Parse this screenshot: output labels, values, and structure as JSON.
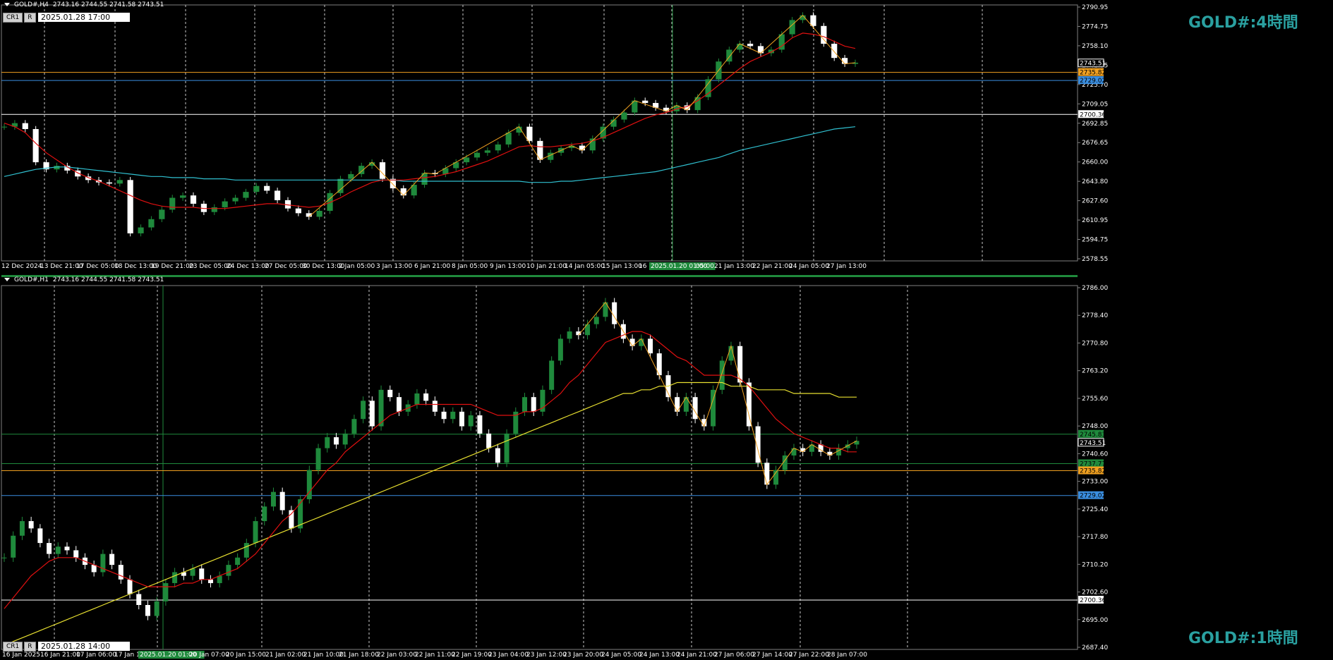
{
  "colors": {
    "bg": "#000000",
    "bull": "#1f8a3c",
    "bear": "#ffffff",
    "ma_fast": "#e01010",
    "ma_mid": "#30c0d0",
    "ma_slow": "#e8e030",
    "zigzag": "#f0a020",
    "grid": "#c8c8c8",
    "hline_white": "#ffffff",
    "hline_orange": "#f0a020",
    "hline_blue": "#3a8ee0",
    "hline_green": "#1f8a3c",
    "watermark": "#2aa0a0"
  },
  "panes": [
    {
      "id": "h4",
      "header": {
        "symbol": "GOLD#,H4",
        "ohlc": "2743.16 2744.55 2741.58 2743.51"
      },
      "buttons": [
        "CR1",
        "R"
      ],
      "datetime_box": "2025.01.28 17:00",
      "watermark": "GOLD#:4時間",
      "y_ticks": [
        "2790.95",
        "2774.75",
        "2758.10",
        "2741.35",
        "2725.70",
        "2709.05",
        "2692.85",
        "2676.65",
        "2660.00",
        "2643.80",
        "2627.60",
        "2610.95",
        "2594.75",
        "2578.55"
      ],
      "x_ticks": [
        "12 Dec 2024",
        "13 Dec 21:00",
        "17 Dec 05:00",
        "18 Dec 13:00",
        "19 Dec 21:00",
        "23 Dec 05:00",
        "24 Dec 13:00",
        "27 Dec 05:00",
        "30 Dec 13:00",
        "2 Jan 05:00",
        "3 Jan 13:00",
        "6 Jan 21:00",
        "8 Jan 05:00",
        "9 Jan 13:00",
        "10 Jan 21:00",
        "14 Jan 05:00",
        "15 Jan 13:00",
        "16",
        "2025.01.20 01:00",
        "05:00",
        "21 Jan 13:00",
        "22 Jan 21:00",
        "24 Jan 05:00",
        "27 Jan 13:00"
      ],
      "price_tags": [
        {
          "text": "2743.51",
          "price": 2743.51,
          "style": "current"
        },
        {
          "text": "2735.82",
          "price": 2735.82,
          "style": "orange"
        },
        {
          "text": "2729.02",
          "price": 2729.02,
          "style": "blue"
        },
        {
          "text": "2700.36",
          "price": 2700.36,
          "style": "white"
        }
      ]
    },
    {
      "id": "h1",
      "header": {
        "symbol": "GOLD#,H1",
        "ohlc": "2743.16 2744.55 2741.58 2743.51"
      },
      "buttons": [
        "CR1",
        "R"
      ],
      "datetime_box": "2025.01.28 14:00",
      "watermark": "GOLD#:1時間",
      "y_ticks": [
        "2786.00",
        "2778.40",
        "2770.80",
        "2763.20",
        "2755.60",
        "2748.00",
        "2740.60",
        "2733.00",
        "2725.40",
        "2717.80",
        "2710.20",
        "2702.60",
        "2695.00",
        "2687.40"
      ],
      "x_ticks": [
        "16 Jan 2025",
        "16 Jan 21:00",
        "17 Jan 06:00",
        "17 Jan 14",
        "2025.01.20 01:00",
        "20 Jan 07:00",
        "20 Jan 15:00",
        "21 Jan 02:00",
        "21 Jan 10:00",
        "21 Jan 18:00",
        "22 Jan 03:00",
        "22 Jan 11:00",
        "22 Jan 19:00",
        "23 Jan 04:00",
        "23 Jan 12:00",
        "23 Jan 20:00",
        "24 Jan 05:00",
        "24 Jan 13:00",
        "24 Jan 21:00",
        "27 Jan 06:00",
        "27 Jan 14:00",
        "27 Jan 22:00",
        "28 Jan 07:00"
      ],
      "price_tags": [
        {
          "text": "2745.83",
          "price": 2745.83,
          "style": "green"
        },
        {
          "text": "2743.51",
          "price": 2743.51,
          "style": "current"
        },
        {
          "text": "2737.77",
          "price": 2737.77,
          "style": "green"
        },
        {
          "text": "2735.82",
          "price": 2735.82,
          "style": "orange"
        },
        {
          "text": "2729.02",
          "price": 2729.02,
          "style": "blue"
        },
        {
          "text": "2700.36",
          "price": 2700.36,
          "style": "white"
        }
      ]
    }
  ],
  "chart_data": [
    {
      "type": "candlestick",
      "title": "GOLD#,H4",
      "ylim": [
        2578.55,
        2790.95
      ],
      "horizontal_lines": [
        2735.82,
        2729.02,
        2700.36
      ],
      "close_path": [
        2690,
        2693,
        2688,
        2660,
        2654,
        2657,
        2653,
        2648,
        2645,
        2643,
        2642,
        2645,
        2600,
        2605,
        2612,
        2620,
        2630,
        2632,
        2625,
        2618,
        2622,
        2627,
        2630,
        2635,
        2640,
        2636,
        2628,
        2621,
        2617,
        2614,
        2619,
        2634,
        2646,
        2650,
        2657,
        2660,
        2646,
        2638,
        2632,
        2641,
        2651,
        2650,
        2655,
        2660,
        2664,
        2668,
        2670,
        2675,
        2685,
        2690,
        2678,
        2662,
        2668,
        2672,
        2674,
        2670,
        2680,
        2690,
        2696,
        2702,
        2712,
        2710,
        2706,
        2703,
        2708,
        2704,
        2715,
        2730,
        2745,
        2755,
        2760,
        2758,
        2752,
        2755,
        2768,
        2780,
        2784,
        2775,
        2760,
        2748,
        2743,
        2744
      ],
      "ma_fast": [
        2693,
        2690,
        2685,
        2676,
        2668,
        2662,
        2656,
        2651,
        2647,
        2644,
        2640,
        2636,
        2632,
        2628,
        2625,
        2623,
        2622,
        2622,
        2622,
        2621,
        2621,
        2621,
        2622,
        2623,
        2624,
        2625,
        2625,
        2624,
        2623,
        2622,
        2623,
        2626,
        2630,
        2635,
        2639,
        2643,
        2645,
        2645,
        2645,
        2646,
        2647,
        2648,
        2650,
        2652,
        2655,
        2658,
        2661,
        2665,
        2669,
        2673,
        2674,
        2673,
        2673,
        2674,
        2675,
        2676,
        2678,
        2681,
        2685,
        2689,
        2693,
        2697,
        2700,
        2702,
        2705,
        2707,
        2712,
        2718,
        2725,
        2732,
        2739,
        2745,
        2749,
        2753,
        2758,
        2765,
        2769,
        2768,
        2766,
        2762,
        2758,
        2756
      ],
      "ma_slow": [
        2648,
        2650,
        2652,
        2654,
        2655,
        2656,
        2656,
        2655,
        2654,
        2653,
        2652,
        2651,
        2650,
        2649,
        2648,
        2648,
        2647,
        2647,
        2647,
        2646,
        2646,
        2646,
        2645,
        2645,
        2645,
        2645,
        2645,
        2645,
        2645,
        2645,
        2645,
        2645,
        2645,
        2645,
        2645,
        2645,
        2645,
        2645,
        2644,
        2644,
        2644,
        2644,
        2644,
        2644,
        2644,
        2644,
        2644,
        2644,
        2644,
        2644,
        2643,
        2643,
        2643,
        2644,
        2644,
        2645,
        2646,
        2647,
        2648,
        2649,
        2650,
        2651,
        2652,
        2654,
        2656,
        2658,
        2660,
        2662,
        2664,
        2667,
        2670,
        2672,
        2674,
        2676,
        2678,
        2680,
        2682,
        2684,
        2686,
        2688,
        2689,
        2690
      ]
    },
    {
      "type": "candlestick",
      "title": "GOLD#,H1",
      "ylim": [
        2687.4,
        2786.0
      ],
      "horizontal_lines": [
        2745.83,
        2737.77,
        2735.82,
        2729.02,
        2700.36
      ],
      "close_path": [
        2712,
        2718,
        2722,
        2720,
        2716,
        2713,
        2715,
        2714,
        2712,
        2710,
        2708,
        2713,
        2710,
        2706,
        2702,
        2699,
        2696,
        2700,
        2705,
        2708,
        2707,
        2709,
        2706,
        2705,
        2707,
        2710,
        2712,
        2716,
        2722,
        2726,
        2730,
        2725,
        2720,
        2728,
        2736,
        2742,
        2745,
        2743,
        2746,
        2750,
        2755,
        2748,
        2758,
        2756,
        2752,
        2754,
        2757,
        2755,
        2752,
        2750,
        2752,
        2748,
        2751,
        2746,
        2742,
        2738,
        2746,
        2752,
        2756,
        2752,
        2758,
        2766,
        2772,
        2774,
        2773,
        2776,
        2778,
        2782,
        2776,
        2772,
        2770,
        2772,
        2768,
        2762,
        2756,
        2752,
        2756,
        2750,
        2748,
        2758,
        2766,
        2770,
        2760,
        2748,
        2738,
        2732,
        2736,
        2740,
        2742,
        2741,
        2743,
        2741,
        2740,
        2742,
        2743,
        2744
      ],
      "ma_fast": [
        2698,
        2701,
        2704,
        2707,
        2709,
        2711,
        2712,
        2712,
        2712,
        2711,
        2710,
        2709,
        2708,
        2707,
        2706,
        2705,
        2704,
        2704,
        2704,
        2704,
        2705,
        2705,
        2706,
        2706,
        2707,
        2708,
        2709,
        2711,
        2713,
        2716,
        2719,
        2722,
        2724,
        2727,
        2730,
        2733,
        2736,
        2738,
        2741,
        2743,
        2745,
        2747,
        2749,
        2751,
        2752,
        2753,
        2754,
        2754,
        2754,
        2754,
        2754,
        2754,
        2754,
        2753,
        2752,
        2751,
        2751,
        2751,
        2752,
        2752,
        2753,
        2755,
        2757,
        2760,
        2762,
        2765,
        2768,
        2771,
        2772,
        2773,
        2774,
        2774,
        2773,
        2771,
        2769,
        2767,
        2766,
        2764,
        2762,
        2762,
        2762,
        2762,
        2761,
        2759,
        2756,
        2753,
        2750,
        2748,
        2746,
        2745,
        2744,
        2743,
        2742,
        2742,
        2741,
        2741
      ],
      "ma_slow": [
        2688,
        2689,
        2690,
        2691,
        2692,
        2693,
        2694,
        2695,
        2696,
        2697,
        2698,
        2699,
        2700,
        2701,
        2702,
        2703,
        2704,
        2705,
        2706,
        2707,
        2708,
        2709,
        2710,
        2711,
        2712,
        2713,
        2714,
        2715,
        2716,
        2717,
        2718,
        2719,
        2720,
        2721,
        2722,
        2723,
        2724,
        2725,
        2726,
        2727,
        2728,
        2729,
        2730,
        2731,
        2732,
        2733,
        2734,
        2735,
        2736,
        2737,
        2738,
        2739,
        2740,
        2741,
        2742,
        2743,
        2744,
        2745,
        2746,
        2747,
        2748,
        2749,
        2750,
        2751,
        2752,
        2753,
        2754,
        2755,
        2756,
        2757,
        2757,
        2758,
        2758,
        2759,
        2759,
        2760,
        2760,
        2760,
        2760,
        2760,
        2760,
        2759,
        2759,
        2759,
        2758,
        2758,
        2758,
        2758,
        2757,
        2757,
        2757,
        2757,
        2757,
        2756,
        2756,
        2756
      ]
    }
  ]
}
